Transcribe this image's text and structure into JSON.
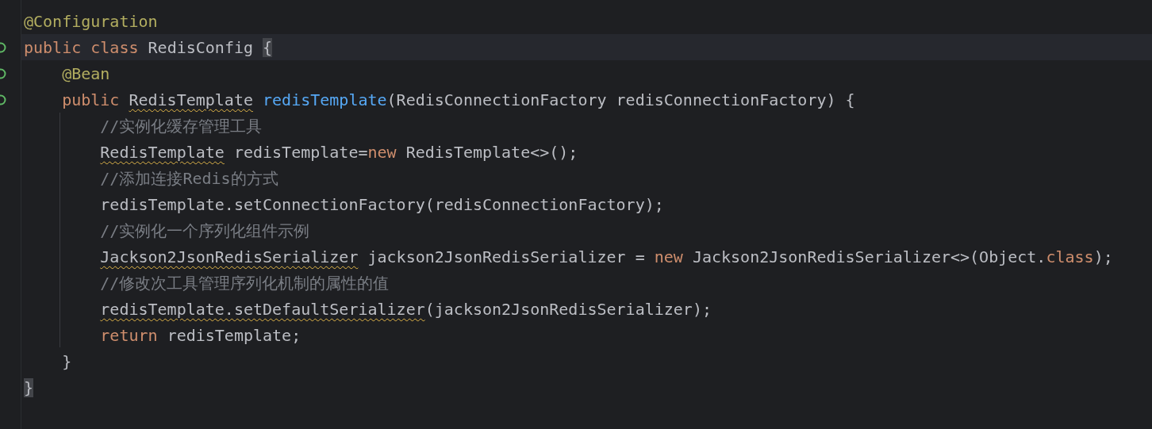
{
  "editor": {
    "lines": [
      {
        "current": false,
        "tokens": [
          {
            "text": "@Configuration",
            "kind": "annotation"
          }
        ]
      },
      {
        "current": true,
        "tokens": [
          {
            "text": "public class ",
            "kind": "keyword"
          },
          {
            "text": "RedisConfig ",
            "kind": "plain"
          },
          {
            "text": "{",
            "kind": "plain",
            "matched": true
          }
        ]
      },
      {
        "current": false,
        "tokens": [
          {
            "text": "    @Bean",
            "kind": "annotation"
          }
        ]
      },
      {
        "current": false,
        "tokens": [
          {
            "text": "    public ",
            "kind": "keyword"
          },
          {
            "text": "RedisTemplate",
            "kind": "plain",
            "warning": true
          },
          {
            "text": " redisTemplate",
            "kind": "method"
          },
          {
            "text": "(RedisConnectionFactory redisConnectionFactory) {",
            "kind": "plain"
          }
        ]
      },
      {
        "current": false,
        "tokens": [
          {
            "text": "        //实例化缓存管理工具",
            "kind": "comment"
          }
        ]
      },
      {
        "current": false,
        "tokens": [
          {
            "text": "        RedisTemplate",
            "kind": "plain",
            "warning": true
          },
          {
            "text": " redisTemplate=",
            "kind": "plain"
          },
          {
            "text": "new ",
            "kind": "keyword"
          },
          {
            "text": "RedisTemplate<>();",
            "kind": "plain"
          }
        ]
      },
      {
        "current": false,
        "tokens": [
          {
            "text": "        //添加连接Redis的方式",
            "kind": "comment"
          }
        ]
      },
      {
        "current": false,
        "tokens": [
          {
            "text": "        redisTemplate.setConnectionFactory(redisConnectionFactory);",
            "kind": "plain"
          }
        ]
      },
      {
        "current": false,
        "tokens": [
          {
            "text": "        //实例化一个序列化组件示例",
            "kind": "comment"
          }
        ]
      },
      {
        "current": false,
        "tokens": [
          {
            "text": "        Jackson2JsonRedisSerializer",
            "kind": "plain",
            "warning": true
          },
          {
            "text": " jackson2JsonRedisSerializer = ",
            "kind": "plain"
          },
          {
            "text": "new ",
            "kind": "keyword"
          },
          {
            "text": "Jackson2JsonRedisSerializer<>(Object.",
            "kind": "plain"
          },
          {
            "text": "class",
            "kind": "keyword"
          },
          {
            "text": ");",
            "kind": "plain"
          }
        ]
      },
      {
        "current": false,
        "tokens": [
          {
            "text": "        //修改次工具管理序列化机制的属性的值",
            "kind": "comment"
          }
        ]
      },
      {
        "current": false,
        "tokens": [
          {
            "text": "        redisTemplate.setDefaultSerializer",
            "kind": "plain",
            "warning": true
          },
          {
            "text": "(jackson2JsonRedisSerializer);",
            "kind": "plain"
          }
        ]
      },
      {
        "current": false,
        "tokens": [
          {
            "text": "        return ",
            "kind": "keyword"
          },
          {
            "text": "redisTemplate;",
            "kind": "plain"
          }
        ]
      },
      {
        "current": false,
        "tokens": [
          {
            "text": "    }",
            "kind": "plain"
          }
        ]
      },
      {
        "current": false,
        "tokens": [
          {
            "text": "}",
            "kind": "plain",
            "matched": true
          }
        ]
      }
    ]
  }
}
